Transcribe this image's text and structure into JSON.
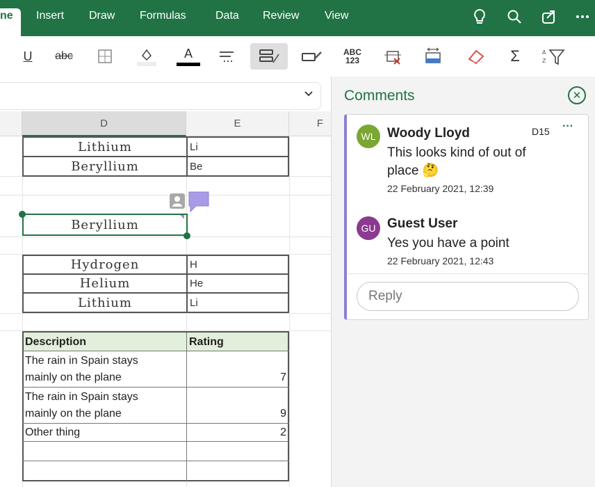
{
  "menu": {
    "tabs": [
      "ne",
      "Insert",
      "Draw",
      "Formulas",
      "Data",
      "Review",
      "View"
    ]
  },
  "ribbon": {
    "underline": "U",
    "strike": "abc",
    "font_color_letter": "A",
    "spell": "ABC\n123",
    "sum": "Σ"
  },
  "grid": {
    "columns": [
      "D",
      "E",
      "F"
    ],
    "rows_top": [
      {
        "d": "Lithium",
        "e": "Li"
      },
      {
        "d": "Beryllium",
        "e": "Be"
      }
    ],
    "selected_cell": "Beryllium",
    "rows_mid": [
      {
        "d": "Hydrogen",
        "e": "H"
      },
      {
        "d": "Helium",
        "e": "He"
      },
      {
        "d": "Lithium",
        "e": "Li"
      }
    ],
    "table": {
      "headers": [
        "Description",
        "Rating"
      ],
      "rows": [
        {
          "desc_line1": "The rain in Spain stays",
          "desc_line2": "mainly on the plane",
          "rating": "7"
        },
        {
          "desc_line1": "The rain in Spain stays",
          "desc_line2": "mainly on the plane",
          "rating": "9"
        },
        {
          "desc_line1": "Other thing",
          "desc_line2": "",
          "rating": "2"
        }
      ]
    }
  },
  "comments": {
    "title": "Comments",
    "cell_ref": "D15",
    "more": "···",
    "thread": [
      {
        "initials": "WL",
        "name": "Woody Lloyd",
        "text_line1": "This looks kind of out of",
        "text_line2": "place 🤔",
        "date": "22 February 2021, 12:39",
        "color": "#7aa632"
      },
      {
        "initials": "GU",
        "name": "Guest User",
        "text_line1": "Yes you have a point",
        "text_line2": "",
        "date": "22 February 2021, 12:43",
        "color": "#8b3a8f"
      }
    ],
    "reply_placeholder": "Reply"
  },
  "colors": {
    "brand": "#217346",
    "thread_accent": "#8a7fd3",
    "table_header": "#e2efda"
  }
}
